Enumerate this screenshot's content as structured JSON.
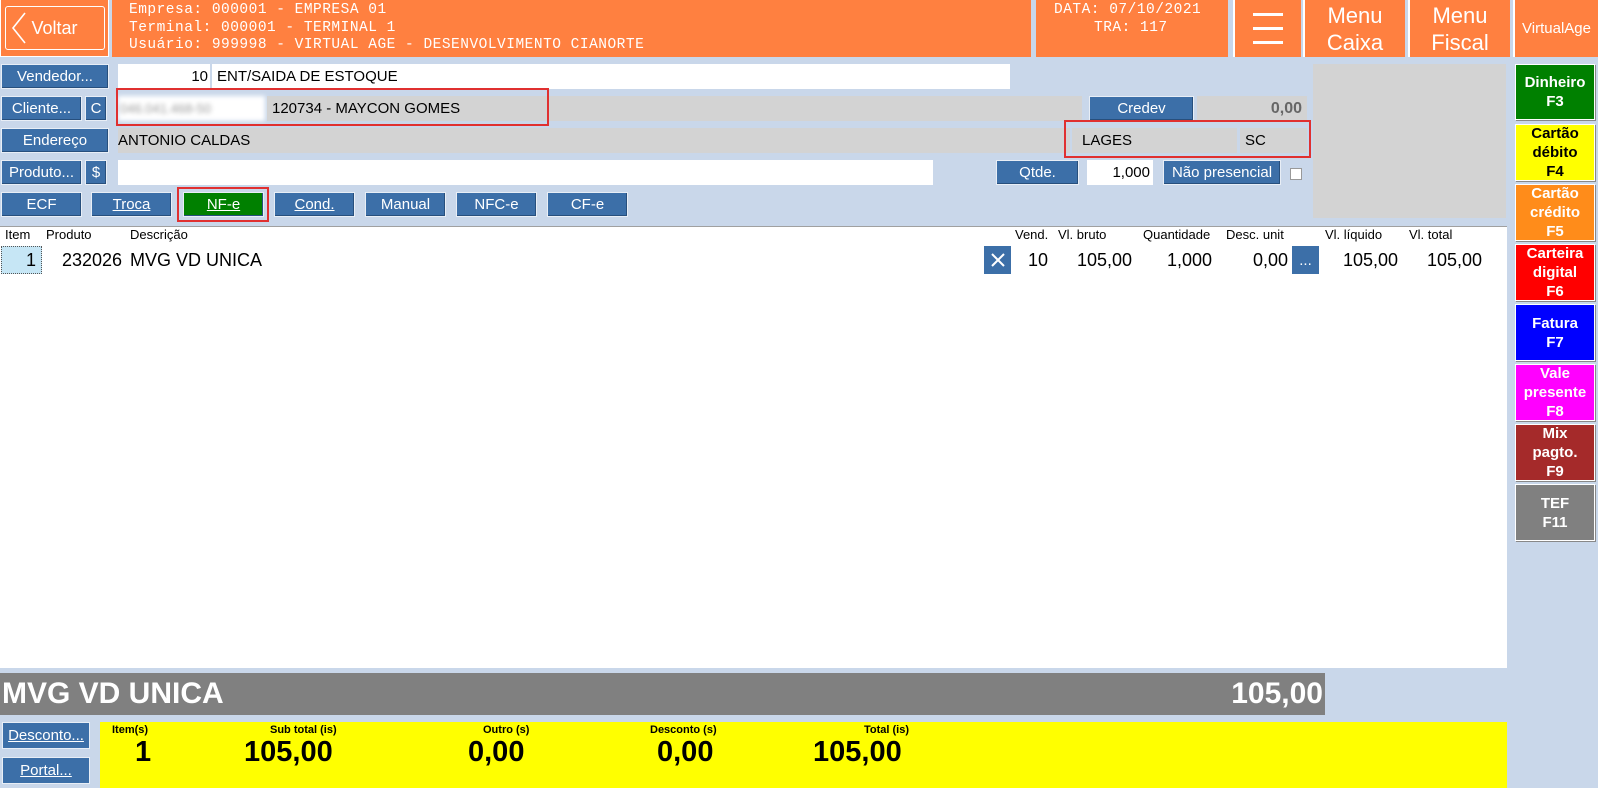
{
  "header": {
    "back_label": "Voltar",
    "empresa": "Empresa: 000001 - EMPRESA 01",
    "terminal": "Terminal: 000001 - TERMINAL 1",
    "usuario": "Usuário: 999998 - VIRTUAL AGE - DESENVOLVIMENTO CIANORTE",
    "data": "DATA: 07/10/2021",
    "tra": "TRA: 117",
    "menu_caixa_1": "Menu",
    "menu_caixa_2": "Caixa",
    "menu_fiscal_1": "Menu",
    "menu_fiscal_2": "Fiscal",
    "brand": "VirtualAge"
  },
  "form": {
    "vendedor_label": "Vendedor...",
    "vendedor_code": "10",
    "vendedor_name": "ENT/SAIDA DE ESTOQUE",
    "cliente_label": "Cliente...",
    "cliente_c": "C",
    "cliente_doc": "046.041.468-50",
    "cliente_name": "120734 - MAYCON GOMES",
    "credev_label": "Credev",
    "credev_value": "0,00",
    "endereco_label": "Endereço",
    "endereco_value": "ANTONIO CALDAS",
    "cidade": "LAGES",
    "uf": "SC",
    "produto_label": "Produto...",
    "produto_dollar": "$",
    "produto_value": "",
    "qtde_label": "Qtde.",
    "qtde_value": "1,000",
    "nao_presencial_label": "Não presencial"
  },
  "doc_types": [
    {
      "label": "ECF"
    },
    {
      "label": "Troca"
    },
    {
      "label": "NF-e",
      "active": true
    },
    {
      "label": "Cond."
    },
    {
      "label": "Manual"
    },
    {
      "label": "NFC-e"
    },
    {
      "label": "CF-e"
    }
  ],
  "grid": {
    "headers": {
      "item": "Item",
      "produto": "Produto",
      "descricao": "Descrição",
      "vend": "Vend.",
      "vl_bruto": "Vl. bruto",
      "quantidade": "Quantidade",
      "desc_unit": "Desc. unit",
      "vl_liquido": "Vl. líquido",
      "vl_total": "Vl. total"
    },
    "rows": [
      {
        "item": "1",
        "produto": "232026",
        "descricao": "MVG VD UNICA",
        "vend": "10",
        "vl_bruto": "105,00",
        "quantidade": "1,000",
        "desc_unit": "0,00",
        "more": "...",
        "vl_liquido": "105,00",
        "vl_total": "105,00"
      }
    ]
  },
  "banner": {
    "product": "MVG VD UNICA",
    "value": "105,00"
  },
  "totals": {
    "items_label": "Item(s)",
    "items_value": "1",
    "subtotal_label": "Sub total (is)",
    "subtotal_value": "105,00",
    "outro_label": "Outro (s)",
    "outro_value": "0,00",
    "desconto_label": "Desconto (s)",
    "desconto_value": "0,00",
    "total_label": "Total (is)",
    "total_value": "105,00"
  },
  "footer": {
    "desconto_btn": "Desconto...",
    "portal_btn": "Portal..."
  },
  "payments": [
    {
      "line1": "Dinheiro",
      "line2": "F3",
      "color": "#008000",
      "text": "#ffffff"
    },
    {
      "line1": "Cartão",
      "line2": "débito",
      "line3": "F4",
      "color": "#ffff00",
      "text": "#000000"
    },
    {
      "line1": "Cartão",
      "line2": "crédito",
      "line3": "F5",
      "color": "#ff8c1a",
      "text": "#ffffff"
    },
    {
      "line1": "Carteira",
      "line2": "digital",
      "line3": "F6",
      "color": "#ff0000",
      "text": "#ffffff"
    },
    {
      "line1": "Fatura",
      "line2": "F7",
      "color": "#0000ff",
      "text": "#ffffff"
    },
    {
      "line1": "Vale",
      "line2": "presente",
      "line3": "F8",
      "color": "#ff00ff",
      "text": "#ffffff"
    },
    {
      "line1": "Mix",
      "line2": "pagto.",
      "line3": "F9",
      "color": "#a52a2a",
      "text": "#ffffff"
    },
    {
      "line1": "TEF",
      "line2": "F11",
      "color": "#808080",
      "text": "#ffffff"
    }
  ],
  "colors": {
    "header_orange": "#ff8040",
    "button_blue": "#3c6fa8",
    "active_green": "#008000",
    "totals_yellow": "#ffff00"
  }
}
